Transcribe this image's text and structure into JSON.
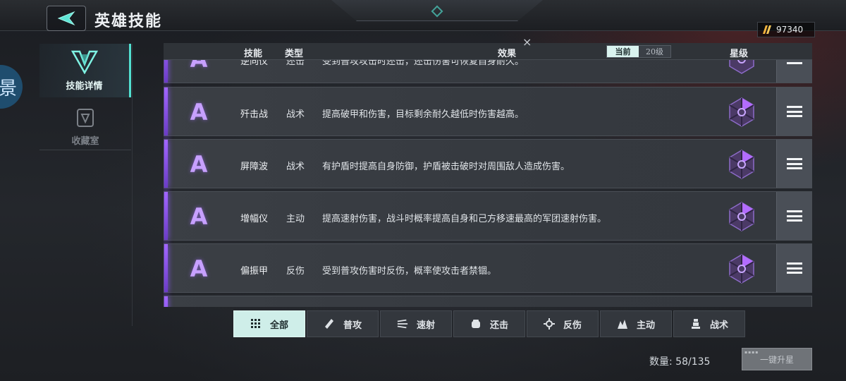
{
  "header": {
    "title": "英雄技能",
    "currency_value": "97340"
  },
  "left_edge_char": "景",
  "sidebar": {
    "items": [
      {
        "label": "技能详情",
        "active": true
      },
      {
        "label": "收藏室",
        "active": false
      }
    ]
  },
  "list_header": {
    "col_skill": "技能",
    "col_type": "类型",
    "col_effect": "效果",
    "toggle_current": "当前",
    "toggle_level": "20级",
    "col_star": "星级"
  },
  "close_symbol": "×",
  "rows": [
    {
      "grade": "A",
      "name": "逆向仪",
      "type": "还击",
      "effect": "受到普攻攻击时还击，还击伤害可恢复自身耐久。"
    },
    {
      "grade": "A",
      "name": "歼击战",
      "type": "战术",
      "effect": "提高破甲和伤害，目标剩余耐久越低时伤害越高。"
    },
    {
      "grade": "A",
      "name": "屏障波",
      "type": "战术",
      "effect": "有护盾时提高自身防御，护盾被击破时对周围敌人造成伤害。"
    },
    {
      "grade": "A",
      "name": "增幅仪",
      "type": "主动",
      "effect": "提高速射伤害，战斗时概率提高自身和己方移速最高的军团速射伤害。"
    },
    {
      "grade": "A",
      "name": "偏振甲",
      "type": "反伤",
      "effect": "受到普攻伤害时反伤，概率使攻击者禁锢。"
    }
  ],
  "tabs": [
    {
      "label": "全部",
      "icon": "grid-icon",
      "active": true
    },
    {
      "label": "普攻",
      "icon": "bullet-icon",
      "active": false
    },
    {
      "label": "速射",
      "icon": "rapid-fire-icon",
      "active": false
    },
    {
      "label": "还击",
      "icon": "fist-icon",
      "active": false
    },
    {
      "label": "反伤",
      "icon": "gear-burst-icon",
      "active": false
    },
    {
      "label": "主动",
      "icon": "active-flame-icon",
      "active": false
    },
    {
      "label": "战术",
      "icon": "tower-icon",
      "active": false
    }
  ],
  "footer": {
    "count_label": "数量: 58/135",
    "upgrade_label": "一键升星"
  },
  "colors": {
    "accent": "#52e0d0",
    "grade_purple": "#a266ff",
    "tab_active_bg": "#cfeee9"
  }
}
